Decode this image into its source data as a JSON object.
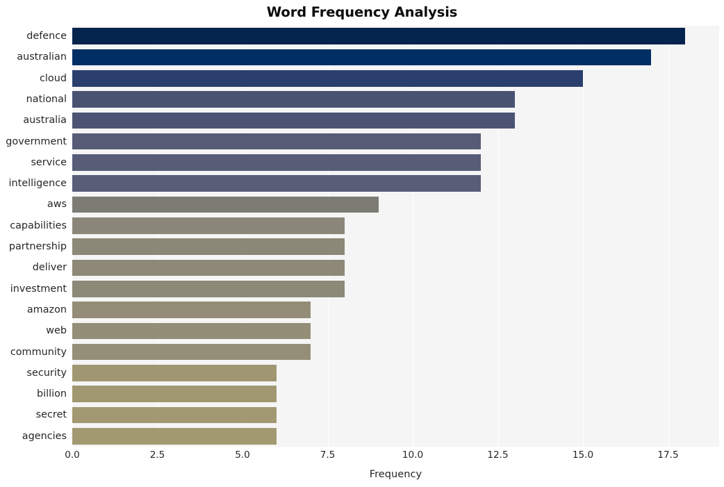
{
  "chart_data": {
    "type": "bar",
    "orientation": "horizontal",
    "title": "Word Frequency Analysis",
    "xlabel": "Frequency",
    "ylabel": "",
    "categories": [
      "defence",
      "australian",
      "cloud",
      "national",
      "australia",
      "government",
      "service",
      "intelligence",
      "aws",
      "capabilities",
      "partnership",
      "deliver",
      "investment",
      "amazon",
      "web",
      "community",
      "security",
      "billion",
      "secret",
      "agencies"
    ],
    "values": [
      18,
      17,
      15,
      13,
      13,
      12,
      12,
      12,
      9,
      8,
      8,
      8,
      8,
      7,
      7,
      7,
      6,
      6,
      6,
      6
    ],
    "xticks": [
      "0.0",
      "2.5",
      "5.0",
      "7.5",
      "10.0",
      "12.5",
      "15.0",
      "17.5"
    ],
    "xtick_values": [
      0.0,
      2.5,
      5.0,
      7.5,
      10.0,
      12.5,
      15.0,
      17.5
    ],
    "xlim": [
      0,
      19
    ],
    "grid": true,
    "grid_color": "#ffffff",
    "legend": "none",
    "plot_background": "#f5f5f5",
    "figure_background": "#ffffff",
    "colormap": "cividis",
    "bar_colors": [
      "#04234d",
      "#022e66",
      "#2b3f6e",
      "#4a5271",
      "#4d5473",
      "#565c76",
      "#575d77",
      "#585e78",
      "#7c7b74",
      "#8b8778",
      "#8c8878",
      "#8d8878",
      "#8d8979",
      "#938d78",
      "#948e78",
      "#958f79",
      "#a09772",
      "#a19871",
      "#a29871",
      "#a39971"
    ]
  }
}
